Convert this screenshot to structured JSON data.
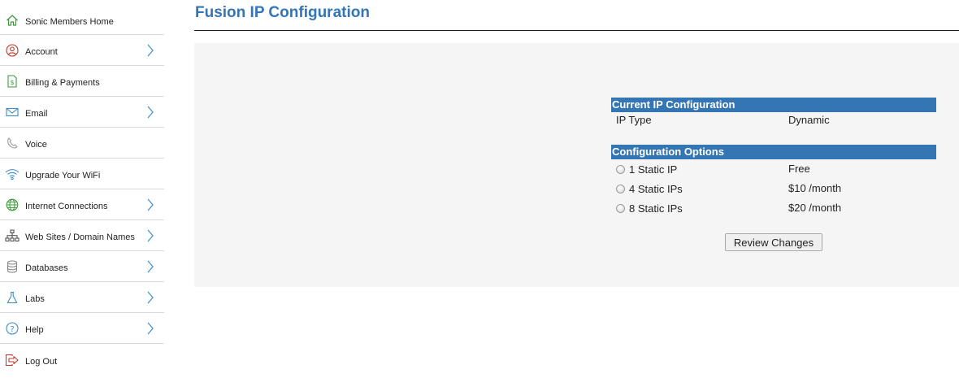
{
  "sidebar": {
    "items": [
      {
        "label": "Sonic Members Home",
        "icon": "home-icon",
        "has_chevron": false
      },
      {
        "label": "Account",
        "icon": "user-icon",
        "has_chevron": true
      },
      {
        "label": "Billing & Payments",
        "icon": "invoice-icon",
        "has_chevron": false
      },
      {
        "label": "Email",
        "icon": "envelope-icon",
        "has_chevron": true
      },
      {
        "label": "Voice",
        "icon": "phone-icon",
        "has_chevron": false
      },
      {
        "label": "Upgrade Your WiFi",
        "icon": "wifi-icon",
        "has_chevron": false
      },
      {
        "label": "Internet Connections",
        "icon": "globe-icon",
        "has_chevron": true
      },
      {
        "label": "Web Sites / Domain Names",
        "icon": "sitemap-icon",
        "has_chevron": true
      },
      {
        "label": "Databases",
        "icon": "database-icon",
        "has_chevron": true
      },
      {
        "label": "Labs",
        "icon": "flask-icon",
        "has_chevron": true
      },
      {
        "label": "Help",
        "icon": "help-icon",
        "has_chevron": true
      },
      {
        "label": "Log Out",
        "icon": "logout-icon",
        "has_chevron": false
      }
    ]
  },
  "main": {
    "title": "Fusion IP Configuration",
    "current": {
      "header": "Current IP Configuration",
      "ip_type_label": "IP Type",
      "ip_type_value": "Dynamic"
    },
    "options": {
      "header": "Configuration Options",
      "items": [
        {
          "label": "1 Static IP",
          "price": "Free",
          "selected": false
        },
        {
          "label": "4 Static IPs",
          "price": "$10 /month",
          "selected": false
        },
        {
          "label": "8 Static IPs",
          "price": "$20 /month",
          "selected": false
        }
      ]
    },
    "review_button": "Review Changes"
  },
  "colors": {
    "title": "#3375b7",
    "section_header_bg": "#3476b4",
    "panel_bg": "#f5f5f5",
    "icon_green": "#3a9a3a",
    "icon_red": "#c0392b",
    "icon_blue": "#3b8ccc",
    "icon_gray": "#888888"
  }
}
